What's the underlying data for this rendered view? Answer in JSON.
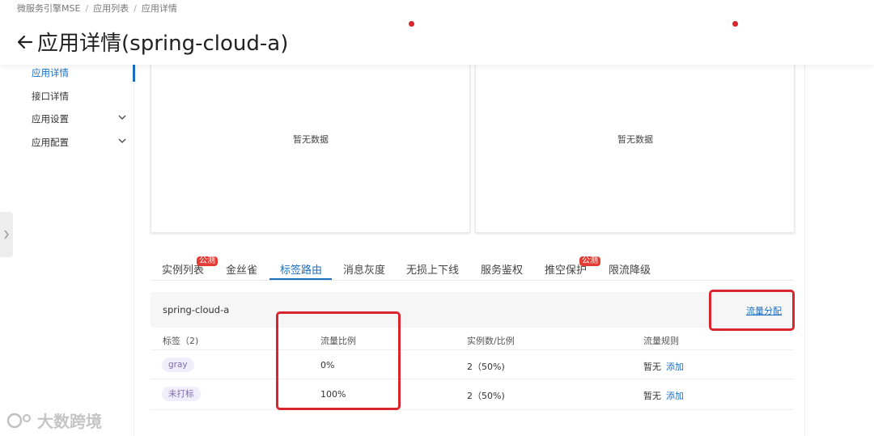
{
  "breadcrumb": [
    "微服务引擎MSE",
    "应用列表",
    "应用详情"
  ],
  "page_title": "应用详情(spring-cloud-a)",
  "sidebar": {
    "items": [
      {
        "label": "应用详情",
        "active": true,
        "expandable": false
      },
      {
        "label": "接口详情",
        "active": false,
        "expandable": false
      },
      {
        "label": "应用设置",
        "active": false,
        "expandable": true
      },
      {
        "label": "应用配置",
        "active": false,
        "expandable": true
      }
    ]
  },
  "panels": {
    "left_empty": "暂无数据",
    "right_empty": "暂无数据"
  },
  "tabs": [
    {
      "label": "实例列表",
      "badge": "公测"
    },
    {
      "label": "金丝雀",
      "badge": ""
    },
    {
      "label": "标签路由",
      "badge": "",
      "active": true
    },
    {
      "label": "消息灰度",
      "badge": ""
    },
    {
      "label": "无损上下线",
      "badge": ""
    },
    {
      "label": "服务鉴权",
      "badge": ""
    },
    {
      "label": "推空保护",
      "badge": "公测"
    },
    {
      "label": "限流降级",
      "badge": ""
    }
  ],
  "card": {
    "service_name": "spring-cloud-a",
    "traffic_link": "流量分配",
    "columns": [
      "标签（2)",
      "流量比例",
      "实例数/比例",
      "流量规则"
    ],
    "rows": [
      {
        "tag": "gray",
        "ratio": "0%",
        "instances": "2（50%)",
        "rule_text": "暂无",
        "rule_action": "添加"
      },
      {
        "tag": "未打标",
        "ratio": "100%",
        "instances": "2（50%)",
        "rule_text": "暂无",
        "rule_action": "添加"
      }
    ]
  },
  "watermark": "大数跨境",
  "colors": {
    "accent": "#1a6fc2",
    "highlight": "#d9262d",
    "badge": "#e23c34"
  }
}
